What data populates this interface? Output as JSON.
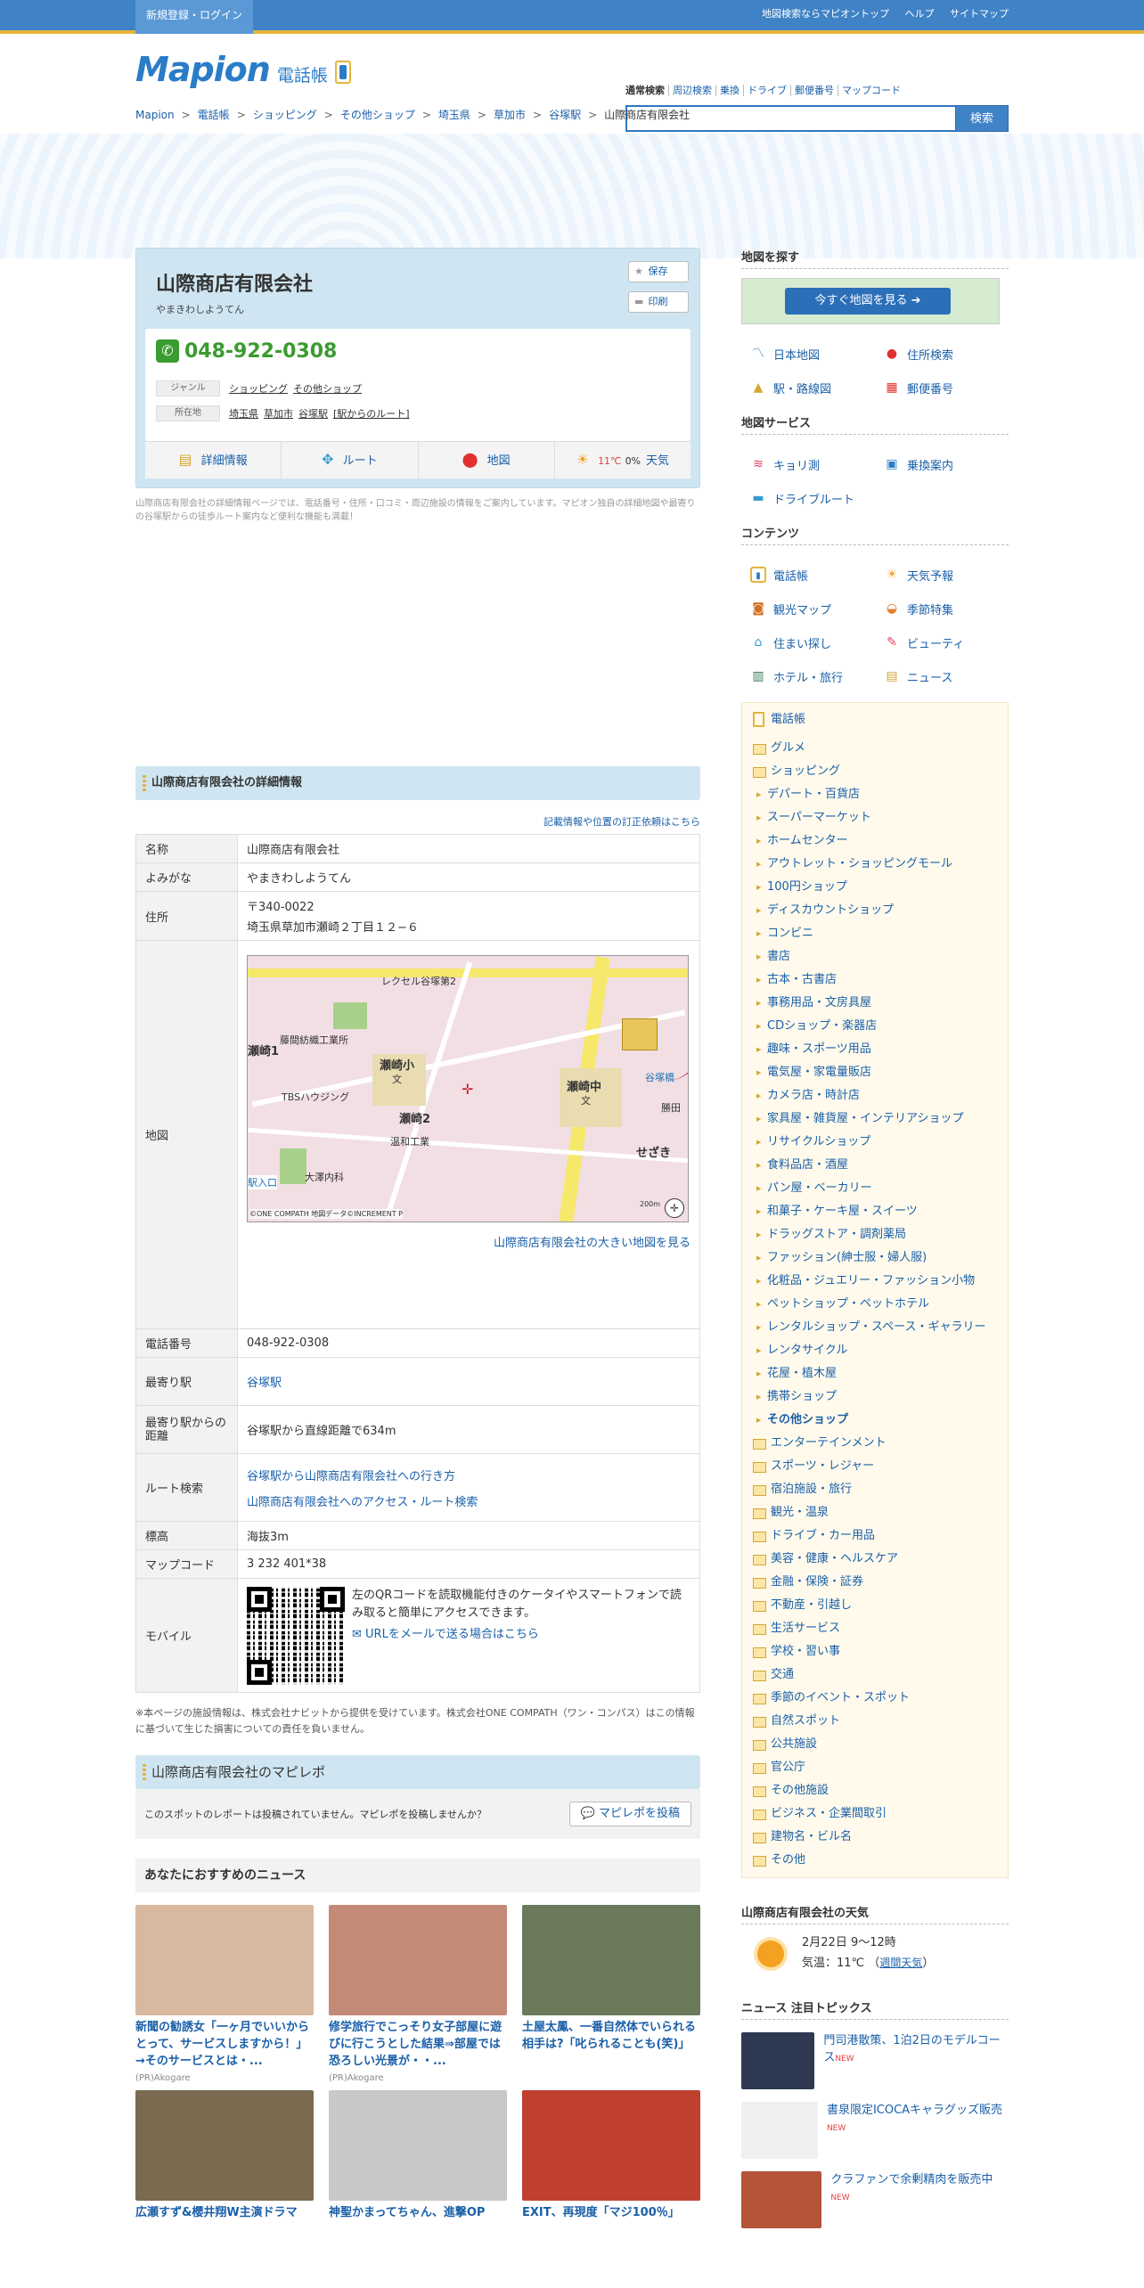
{
  "topbar": {
    "register": "新規登録・ログイン",
    "links": [
      "地図検索ならマピオントップ",
      "ヘルプ",
      "サイトマップ"
    ]
  },
  "logo": {
    "brand": "Mapion",
    "product": "電話帳"
  },
  "search": {
    "tabs": [
      "通常検索",
      "周辺検索",
      "乗換",
      "ドライブ",
      "郵便番号",
      "マップコード"
    ],
    "button": "検索",
    "value": ""
  },
  "breadcrumb": [
    "Mapion",
    "電話帳",
    "ショッピング",
    "その他ショップ",
    "埼玉県",
    "草加市",
    "谷塚駅",
    "山際商店有限会社"
  ],
  "shop": {
    "name": "山際商店有限会社",
    "yomi": "やまきわしようてん",
    "phone": "048-922-0308",
    "save": "保存",
    "print": "印刷",
    "genre_label": "ジャンル",
    "genres": [
      "ショッピング",
      "その他ショップ"
    ],
    "addr_label": "所在地",
    "addr_links": [
      "埼玉県",
      "草加市",
      "谷塚駅",
      "[駅からのルート]"
    ],
    "tabs": {
      "detail": "詳細情報",
      "route": "ルート",
      "map": "地図",
      "weather_temp": "11℃",
      "weather_pct": "0%",
      "weather": "天気"
    },
    "note": "山際商店有限会社の詳細情報ページでは、電話番号・住所・口コミ・周辺施設の情報をご案内しています。マピオン独自の詳細地図や最寄りの谷塚駅からの徒歩ルート案内など便利な機能も満載！"
  },
  "detail": {
    "heading": "山際商店有限会社の詳細情報",
    "correction": "記載情報や位置の訂正依頼はこちら",
    "rows": {
      "name_h": "名称",
      "name": "山際商店有限会社",
      "yomi_h": "よみがな",
      "yomi": "やまきわしようてん",
      "addr_h": "住所",
      "zip": "〒340-0022",
      "addr": "埼玉県草加市瀬崎２丁目１２−６",
      "map_h": "地図",
      "big_map": "山際商店有限会社の大きい地図を見る",
      "tel_h": "電話番号",
      "tel": "048-922-0308",
      "station_h": "最寄り駅",
      "station": "谷塚駅",
      "dist_h": "最寄り駅からの距離",
      "dist": "谷塚駅から直線距離で634m",
      "route_h": "ルート検索",
      "route1": "谷塚駅から山際商店有限会社への行き方",
      "route2": "山際商店有限会社へのアクセス・ルート検索",
      "elev_h": "標高",
      "elev": "海抜3m",
      "mapcode_h": "マップコード",
      "mapcode": "3 232 401*38",
      "mobile_h": "モバイル",
      "mobile_text": "左のQRコードを読取機能付きのケータイやスマートフォンで読み取ると簡単にアクセスできます。",
      "mobile_link": "URLをメールで送る場合はこちら"
    },
    "map_labels": [
      "レクセル谷塚第2",
      "藤間紡織工業所",
      "瀬崎小",
      "文",
      "TBSハウジング",
      "瀬崎2",
      "瀬崎中",
      "文",
      "温和工業",
      "大澤内科",
      "せざき",
      "谷塚橋",
      "勝田",
      "瀬崎1",
      "駅入口",
      "©ONE COMPATH 地図データ©INCREMENT P",
      "200m"
    ],
    "disclaimer": "※本ページの施設情報は、株式会社ナビットから提供を受けています。株式会社ONE COMPATH（ワン・コンパス）はこの情報に基づいて生じた損害についての責任を負いません。"
  },
  "report": {
    "heading": "山際商店有限会社のマピレポ",
    "text": "このスポットのレポートは投稿されていません。マピレポを投稿しませんか？",
    "button": "マピレポを投稿"
  },
  "news": {
    "heading": "あなたにおすすめのニュース",
    "items": [
      {
        "title": "新聞の勧誘女「一ヶ月でいいからとって、サービスしますから！」→そのサービスとは・...",
        "src": "(PR)Akogare",
        "color": "#d9b8a0"
      },
      {
        "title": "修学旅行でこっそり女子部屋に遊びに行こうとした結果⇒部屋では恐ろしい光景が・・...",
        "src": "(PR)Akogare",
        "color": "#c48a78"
      },
      {
        "title": "土屋太鳳、一番自然体でいられる相手は?「叱られることも(笑)」",
        "src": "",
        "color": "#6b7a5a"
      },
      {
        "title": "広瀬すず&櫻井翔W主演ドラマ",
        "src": "",
        "color": "#7a6a50"
      },
      {
        "title": "神聖かまってちゃん、進撃OP",
        "src": "",
        "color": "#c8c8c8"
      },
      {
        "title": "EXIT、再現度「マジ100％」",
        "src": "",
        "color": "#c04030"
      }
    ]
  },
  "side": {
    "find": "地図を探す",
    "banner": "今すぐ地図を見る",
    "find_links": [
      "日本地図",
      "住所検索",
      "駅・路線図",
      "郵便番号"
    ],
    "service": "地図サービス",
    "service_links": [
      "キョリ測",
      "乗換案内",
      "ドライブルート"
    ],
    "contents": "コンテンツ",
    "contents_links": [
      "電話帳",
      "天気予報",
      "観光マップ",
      "季節特集",
      "住まい探し",
      "ビューティ",
      "ホテル・旅行",
      "ニュース"
    ],
    "cat_top": "電話帳",
    "cats_a": [
      "グルメ",
      "ショッピング"
    ],
    "subs": [
      "デパート・百貨店",
      "スーパーマーケット",
      "ホームセンター",
      "アウトレット・ショッピングモール",
      "100円ショップ",
      "ディスカウントショップ",
      "コンビニ",
      "書店",
      "古本・古書店",
      "事務用品・文房具屋",
      "CDショップ・楽器店",
      "趣味・スポーツ用品",
      "電気屋・家電量販店",
      "カメラ店・時計店",
      "家具屋・雑貨屋・インテリアショップ",
      "リサイクルショップ",
      "食料品店・酒屋",
      "パン屋・ベーカリー",
      "和菓子・ケーキ屋・スイーツ",
      "ドラッグストア・調剤薬局",
      "ファッション(紳士服・婦人服)",
      "化粧品・ジュエリー・ファッション小物",
      "ペットショップ・ペットホテル",
      "レンタルショップ・スペース・ギャラリー",
      "レンタサイクル",
      "花屋・植木屋",
      "携帯ショップ",
      "その他ショップ"
    ],
    "cats_b": [
      "エンターテインメント",
      "スポーツ・レジャー",
      "宿泊施設・旅行",
      "観光・温泉",
      "ドライブ・カー用品",
      "美容・健康・ヘルスケア",
      "金融・保険・証券",
      "不動産・引越し",
      "生活サービス",
      "学校・習い事",
      "交通",
      "季節のイベント・スポット",
      "自然スポット",
      "公共施設",
      "官公庁",
      "その他施設",
      "ビジネス・企業間取引",
      "建物名・ビル名",
      "その他"
    ],
    "weather_h": "山際商店有限会社の天気",
    "weather_date": "2月22日 9～12時",
    "weather_temp_label": "気温：",
    "weather_temp": "11℃",
    "weather_weekly": "週間天気",
    "topics_h": "ニュース 注目トピックス",
    "topics": [
      {
        "t": "門司港散策、1泊2日のモデルコース",
        "n": "NEW",
        "c": "#2d3a52"
      },
      {
        "t": "書泉限定ICOCAキャラグッズ販売",
        "n": "NEW",
        "c": "#eef0f2"
      },
      {
        "t": "クラファンで余剰精肉を販売中",
        "n": "NEW",
        "c": "#b4553a"
      }
    ]
  },
  "colors": {
    "accent": "#3f82c6",
    "phone_green": "#3a9b2f",
    "panel": "#cfe6f2",
    "link": "#1a5fa8"
  }
}
